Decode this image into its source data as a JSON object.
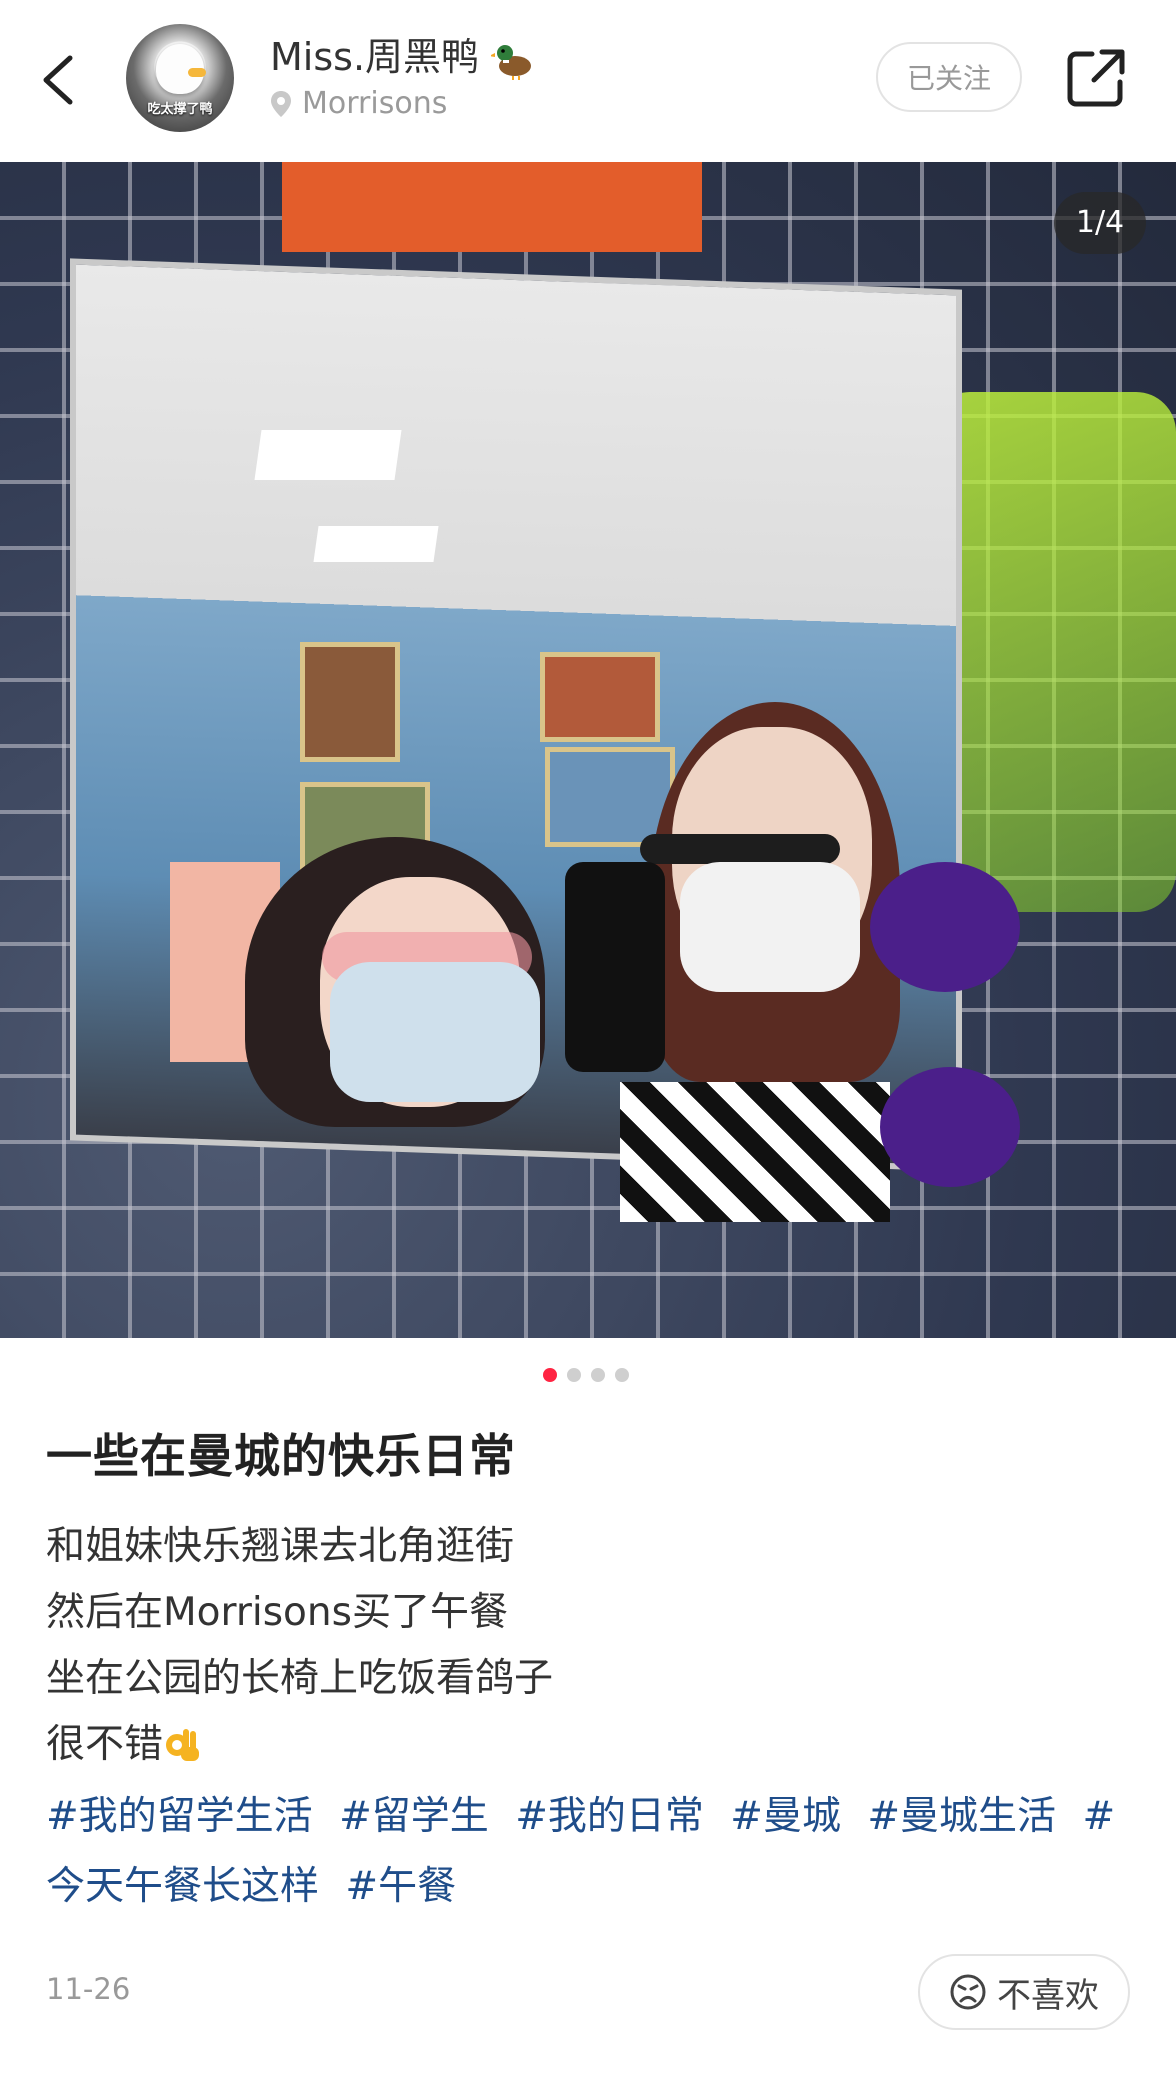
{
  "header": {
    "author_name": "Miss.周黑鸭",
    "avatar_caption": "吃太撑了鸭",
    "location": "Morrisons",
    "follow_label": "已关注",
    "back_icon": "chevron-left-icon",
    "share_icon": "share-icon"
  },
  "photo": {
    "counter": "1/4",
    "current": 1,
    "total": 4
  },
  "post": {
    "title": "一些在曼城的快乐日常",
    "lines": [
      "和姐妹快乐翘课去北角逛街",
      "然后在Morrisons买了午餐",
      "坐在公园的长椅上吃饭看鸽子",
      "很不错"
    ],
    "tags": [
      "#我的留学生活",
      "#留学生",
      "#我的日常",
      "#曼城",
      "#曼城生活",
      "#今天午餐长这样",
      "#午餐"
    ],
    "date": "11-26",
    "dislike_label": "不喜欢"
  },
  "colors": {
    "accent": "#ff2442",
    "tag_color": "#1f4d8a",
    "muted": "#999999"
  }
}
